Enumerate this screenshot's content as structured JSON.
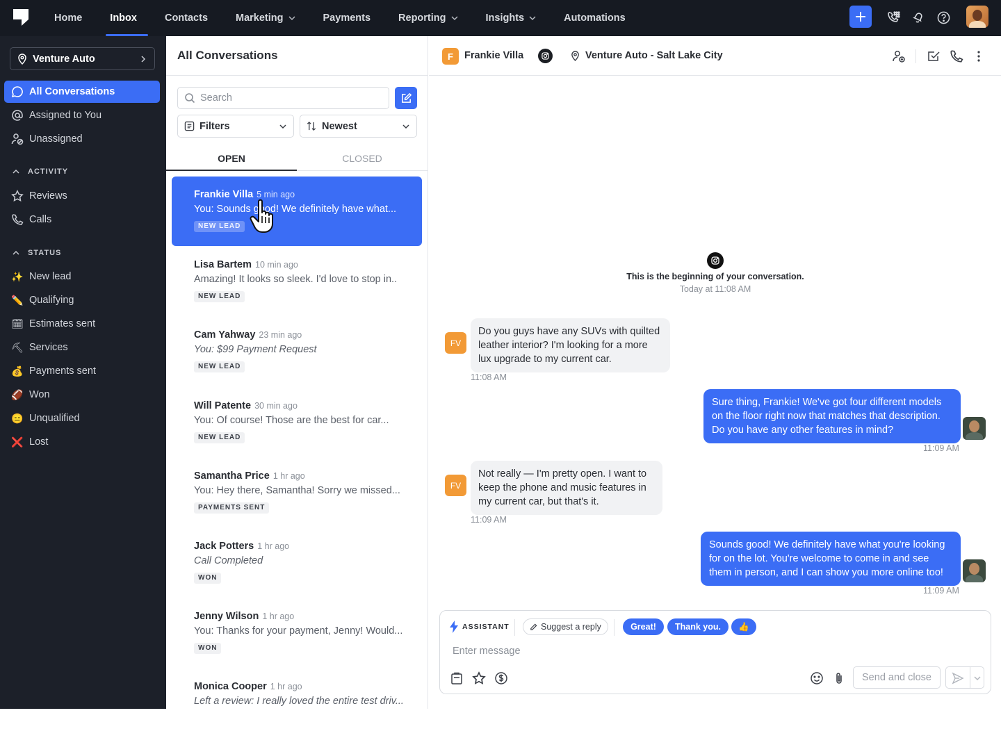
{
  "nav": {
    "items": [
      {
        "label": "Home",
        "dropdown": false
      },
      {
        "label": "Inbox",
        "dropdown": false,
        "active": true
      },
      {
        "label": "Contacts",
        "dropdown": false
      },
      {
        "label": "Marketing",
        "dropdown": true
      },
      {
        "label": "Payments",
        "dropdown": false
      },
      {
        "label": "Reporting",
        "dropdown": true
      },
      {
        "label": "Insights",
        "dropdown": true
      },
      {
        "label": "Automations",
        "dropdown": false
      }
    ],
    "accent": "#3b6df5",
    "background": "#161a22"
  },
  "sidebar": {
    "location": "Venture Auto",
    "main": [
      {
        "label": "All Conversations",
        "icon": "chat-bubble-icon",
        "active": true
      },
      {
        "label": "Assigned to You",
        "icon": "at-icon"
      },
      {
        "label": "Unassigned",
        "icon": "user-unassigned-icon"
      }
    ],
    "activity_heading": "ACTIVITY",
    "activity": [
      {
        "label": "Reviews",
        "icon": "star-icon"
      },
      {
        "label": "Calls",
        "icon": "phone-icon"
      }
    ],
    "status_heading": "STATUS",
    "status": [
      {
        "label": "New lead",
        "emoji": "✨"
      },
      {
        "label": "Qualifying",
        "emoji": "✏️"
      },
      {
        "label": "Estimates sent",
        "emoji": "🗓"
      },
      {
        "label": "Services",
        "emoji": "⛏"
      },
      {
        "label": "Payments sent",
        "emoji": "💰"
      },
      {
        "label": "Won",
        "emoji": "🏈"
      },
      {
        "label": "Unqualified",
        "emoji": "😑"
      },
      {
        "label": "Lost",
        "emoji": "❌"
      }
    ]
  },
  "conversations": {
    "title": "All Conversations",
    "search_placeholder": "Search",
    "filters_label": "Filters",
    "sort_label": "Newest",
    "tabs": {
      "open": "OPEN",
      "closed": "CLOSED"
    },
    "items": [
      {
        "name": "Frankie Villa",
        "time": "5 min ago",
        "preview": "You: Sounds good! We definitely have what...",
        "badge": "NEW LEAD",
        "active": true
      },
      {
        "name": "Lisa Bartem",
        "time": "10 min ago",
        "preview": "Amazing! It looks so sleek. I'd love to stop in..",
        "badge": "NEW LEAD"
      },
      {
        "name": "Cam Yahway",
        "time": "23 min ago",
        "preview": "You: $99 Payment Request",
        "badge": "NEW LEAD",
        "italic": true
      },
      {
        "name": "Will Patente",
        "time": "30 min ago",
        "preview": "You: Of course! Those are the best for car...",
        "badge": "NEW LEAD"
      },
      {
        "name": "Samantha Price",
        "time": "1 hr ago",
        "preview": "You: Hey there, Samantha! Sorry we missed...",
        "badge": "PAYMENTS SENT"
      },
      {
        "name": "Jack Potters",
        "time": "1 hr ago",
        "preview": "Call Completed",
        "badge": "WON",
        "italic": true
      },
      {
        "name": "Jenny Wilson",
        "time": "1 hr ago",
        "preview": "You: Thanks for your payment, Jenny! Would...",
        "badge": "WON"
      },
      {
        "name": "Monica Cooper",
        "time": "1 hr ago",
        "preview": "Left a review: I really loved the entire test driv...",
        "italic": true
      }
    ]
  },
  "chat": {
    "contact_initial": "F",
    "contact_name": "Frankie Villa",
    "location": "Venture Auto - Salt Lake City",
    "beginning_text": "This is the beginning of your conversation.",
    "beginning_time": "Today at 11:08 AM",
    "messages": [
      {
        "direction": "in",
        "initials": "FV",
        "lines": [
          "Do you guys have any SUVs with quilted",
          "leather interior? I'm looking for a more",
          "lux upgrade to my current car."
        ],
        "time": "11:08 AM"
      },
      {
        "direction": "out",
        "lines": [
          "Sure thing, Frankie! We've got four different models",
          "on the floor right now that matches that description.",
          "Do you have any other features in mind?"
        ],
        "time": "11:09 AM"
      },
      {
        "direction": "in",
        "initials": "FV",
        "lines": [
          "Not really — I'm pretty open. I want to",
          "keep the phone and music features in",
          "my current car, but that's it."
        ],
        "time": "11:09 AM"
      },
      {
        "direction": "out",
        "lines": [
          "Sounds good! We definitely have what you're looking",
          "for on the lot. You're welcome to come in and see",
          "them in person, and I can show you more online too!"
        ],
        "time": "11:09 AM"
      }
    ],
    "composer": {
      "assistant_label": "ASSISTANT",
      "suggest_label": "Suggest a reply",
      "quick_replies": [
        "Great!",
        "Thank you.",
        "👍"
      ],
      "placeholder": "Enter message",
      "send_close_label": "Send and close"
    }
  }
}
